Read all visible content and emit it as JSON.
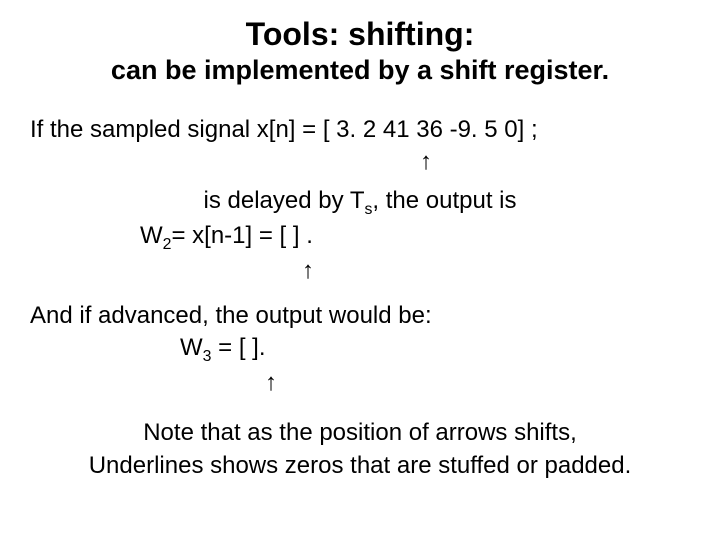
{
  "title": "Tools:   shifting:",
  "subtitle": "can be implemented by a shift register.",
  "line1": "If the sampled signal   x[n] = [ 3. 2  41   36  -9. 5  0] ;",
  "arrow1": "↑",
  "line2_a": "is delayed by T",
  "line2_sub": "s",
  "line2_b": ", the output is",
  "line3_a": "W",
  "line3_sub": "2",
  "line3_b": "= x[n-1] = [                                  ] .",
  "arrow2": "↑",
  "line4": "And if advanced, the output would be:",
  "line5_a": "W",
  "line5_sub": "3",
  "line5_b": " = [                                     ].",
  "arrow3": "↑",
  "line6": "Note that as the position  of arrows  shifts,",
  "line7": "Underlines shows zeros that are stuffed or padded."
}
